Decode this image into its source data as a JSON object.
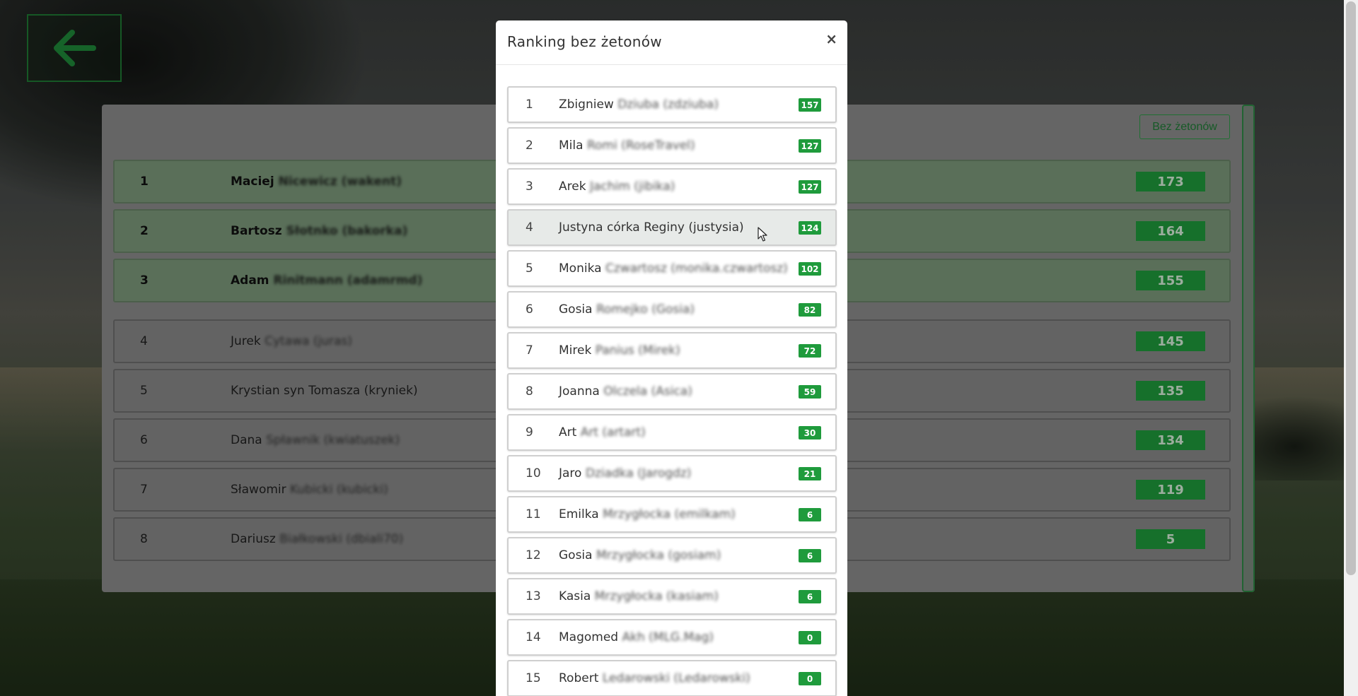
{
  "background_panel": {
    "filter_button": "Bez żetonów",
    "rows": [
      {
        "rank": "1",
        "first": "Maciej",
        "rest": "Nicewicz (wakent)",
        "score": "173",
        "top": true
      },
      {
        "rank": "2",
        "first": "Bartosz",
        "rest": "Słotnko (bakorka)",
        "score": "164",
        "top": true
      },
      {
        "rank": "3",
        "first": "Adam",
        "rest": "Rinitmann (adamrmd)",
        "score": "155",
        "top": true
      },
      {
        "rank": "4",
        "first": "Jurek",
        "rest": "Cytawa (juras)",
        "score": "145",
        "top": false
      },
      {
        "rank": "5",
        "first": "Krystian syn Tomasza (kryniek)",
        "rest": "",
        "score": "135",
        "top": false
      },
      {
        "rank": "6",
        "first": "Dana",
        "rest": "Spławnik (kwiatuszek)",
        "score": "134",
        "top": false
      },
      {
        "rank": "7",
        "first": "Sławomir",
        "rest": "Kubicki (kubicki)",
        "score": "119",
        "top": false
      },
      {
        "rank": "8",
        "first": "Dariusz",
        "rest": "Białkowski (dbiali70)",
        "score": "5",
        "top": false
      }
    ]
  },
  "modal": {
    "title": "Ranking bez żetonów",
    "close": "×",
    "items": [
      {
        "rank": "1",
        "first": "Zbigniew",
        "rest": "Dziuba (zdziuba)",
        "score": "157"
      },
      {
        "rank": "2",
        "first": "Mila",
        "rest": "Romi (RoseTravel)",
        "score": "127"
      },
      {
        "rank": "3",
        "first": "Arek",
        "rest": "Jachim (jibika)",
        "score": "127"
      },
      {
        "rank": "4",
        "first": "Justyna córka Reginy (justysia)",
        "rest": "",
        "score": "124"
      },
      {
        "rank": "5",
        "first": "Monika",
        "rest": "Czwartosz (monika.czwartosz)",
        "score": "102"
      },
      {
        "rank": "6",
        "first": "Gosia",
        "rest": "Romejko (Gosia)",
        "score": "82"
      },
      {
        "rank": "7",
        "first": "Mirek",
        "rest": "Panius (Mirek)",
        "score": "72"
      },
      {
        "rank": "8",
        "first": "Joanna",
        "rest": "Olczela (Asica)",
        "score": "59"
      },
      {
        "rank": "9",
        "first": "Art",
        "rest": "Art (artart)",
        "score": "30"
      },
      {
        "rank": "10",
        "first": "Jaro",
        "rest": "Dziadka (Jarogdz)",
        "score": "21"
      },
      {
        "rank": "11",
        "first": "Emilka",
        "rest": "Mrzygłocka (emilkam)",
        "score": "6"
      },
      {
        "rank": "12",
        "first": "Gosia",
        "rest": "Mrzygłocka (gosiam)",
        "score": "6"
      },
      {
        "rank": "13",
        "first": "Kasia",
        "rest": "Mrzygłocka (kasiam)",
        "score": "6"
      },
      {
        "rank": "14",
        "first": "Magomed",
        "rest": "Akh (MLG.Mag)",
        "score": "0"
      },
      {
        "rank": "15",
        "first": "Robert",
        "rest": "Ledarowski (Ledarowski)",
        "score": "0"
      }
    ]
  },
  "colors": {
    "accent": "#1f9b3c",
    "back_arrow": "#1f8a3a"
  },
  "icons": {
    "back": "arrow-left-icon",
    "cursor": "mouse-pointer-icon"
  }
}
